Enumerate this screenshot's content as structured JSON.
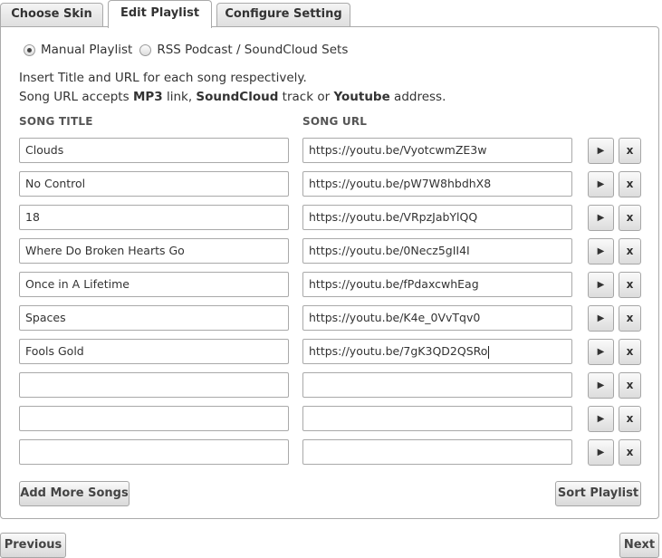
{
  "tabs": [
    {
      "label": "Choose Skin",
      "active": false
    },
    {
      "label": "Edit Playlist",
      "active": true
    },
    {
      "label": "Configure Setting",
      "active": false
    }
  ],
  "mode": {
    "options": [
      {
        "label": "Manual Playlist",
        "checked": true
      },
      {
        "label": "RSS Podcast / SoundCloud Sets",
        "checked": false
      }
    ]
  },
  "help": {
    "line1": "Insert Title and URL for each song respectively.",
    "line2_pre": "Song URL accepts ",
    "line2_mp3": "MP3",
    "line2_mid1": " link, ",
    "line2_sc": "SoundCloud",
    "line2_mid2": " track or ",
    "line2_yt": "Youtube",
    "line2_post": " address."
  },
  "columns": {
    "title": "SONG TITLE",
    "url": "SONG URL"
  },
  "songs": [
    {
      "title": "Clouds",
      "url": "https://youtu.be/VyotcwmZE3w"
    },
    {
      "title": "No Control",
      "url": "https://youtu.be/pW7W8hbdhX8"
    },
    {
      "title": "18",
      "url": "https://youtu.be/VRpzJabYlQQ"
    },
    {
      "title": "Where Do Broken Hearts Go",
      "url": "https://youtu.be/0Necz5gII4I"
    },
    {
      "title": "Once in A Lifetime",
      "url": "https://youtu.be/fPdaxcwhEag"
    },
    {
      "title": "Spaces",
      "url": "https://youtu.be/K4e_0VvTqv0"
    },
    {
      "title": "Fools Gold",
      "url": "https://youtu.be/7gK3QD2QSRo"
    },
    {
      "title": "",
      "url": ""
    },
    {
      "title": "",
      "url": ""
    },
    {
      "title": "",
      "url": ""
    }
  ],
  "row_buttons": {
    "play": "▶",
    "delete": "x"
  },
  "actions": {
    "add_more": "Add More Songs",
    "sort": "Sort Playlist",
    "previous": "Previous",
    "next": "Next"
  }
}
